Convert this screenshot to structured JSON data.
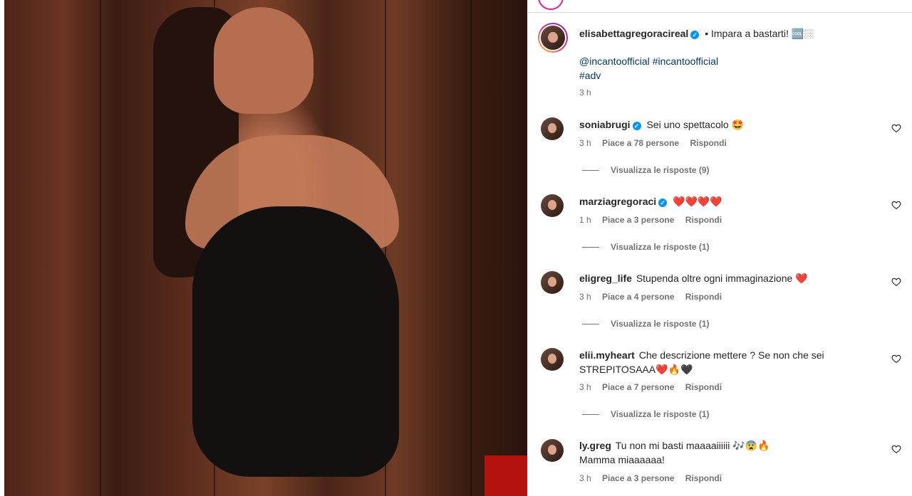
{
  "post": {
    "author": "elisabettagregoracireal",
    "caption": "• Impara a bastarti!",
    "caption_emoji": "🆒🏼",
    "tag_account": "@incantoofficial",
    "tag_hashtag": "#incantoofficial",
    "tag_adv": "#adv",
    "time": "3 h"
  },
  "comments": [
    {
      "user": "soniabrugi",
      "verified": true,
      "text": "Sei uno spettacolo",
      "emoji": "🤩",
      "time": "3 h",
      "likes": "Piace a 78 persone",
      "reply": "Rispondi",
      "view_replies": "Visualizza le risposte (9)"
    },
    {
      "user": "marziagregoraci",
      "verified": true,
      "text": "",
      "emoji": "❤️❤️❤️❤️",
      "time": "1 h",
      "likes": "Piace a 3 persone",
      "reply": "Rispondi",
      "view_replies": "Visualizza le risposte (1)"
    },
    {
      "user": "eligreg_life",
      "verified": false,
      "text": "Stupenda oltre ogni immaginazione",
      "emoji": "❤️",
      "time": "3 h",
      "likes": "Piace a 4 persone",
      "reply": "Rispondi",
      "view_replies": "Visualizza le risposte (1)"
    },
    {
      "user": "elii.myheart",
      "verified": false,
      "text": "Che descrizione mettere ? Se non che sei",
      "text2": "STREPITOSAAA",
      "emoji": "❤️🔥🖤",
      "time": "3 h",
      "likes": "Piace a 7 persone",
      "reply": "Rispondi",
      "view_replies": "Visualizza le risposte (1)"
    },
    {
      "user": "ly.greg",
      "verified": false,
      "text": "Tu non mi basti maaaaiiiiii",
      "emoji": "🎶😨🔥",
      "text2": "Mamma miaaaaaa!",
      "time": "3 h",
      "likes": "Piace a 3 persone",
      "reply": "Rispondi"
    }
  ],
  "icons": {
    "like": "heart-outline-icon",
    "verified": "verified-badge-icon"
  },
  "colors": {
    "link": "#00376b",
    "verified": "#0095f6",
    "meta": "#737373"
  }
}
